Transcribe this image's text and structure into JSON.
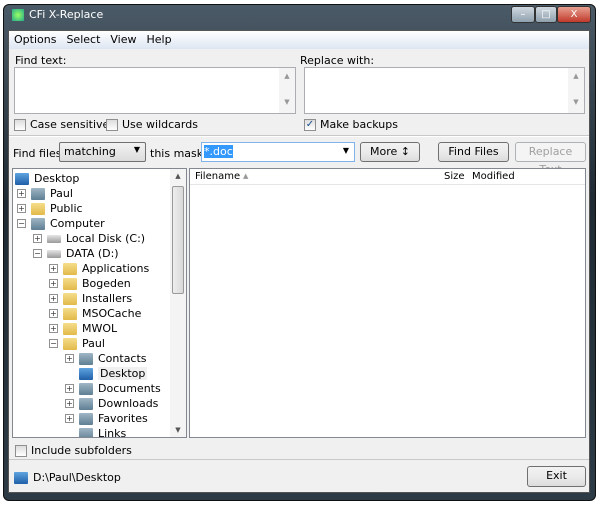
{
  "window": {
    "title": "CFi X-Replace",
    "minimize": "–",
    "maximize": "□",
    "close": "X"
  },
  "menu": [
    {
      "label": "Options"
    },
    {
      "label": "Select"
    },
    {
      "label": "View"
    },
    {
      "label": "Help"
    }
  ],
  "find_text": {
    "label": "Find text:",
    "value": ""
  },
  "replace_with": {
    "label": "Replace with:",
    "value": ""
  },
  "options": {
    "case_sensitive": {
      "label": "Case sensitive",
      "checked": false
    },
    "use_wildcards": {
      "label": "Use wildcards",
      "checked": false
    },
    "make_backups": {
      "label": "Make backups",
      "checked": true,
      "mark": "✓"
    }
  },
  "find_files": {
    "label": "Find files",
    "mode": "matching",
    "mask_label": "this mask:",
    "mask_value": "*.doc",
    "more": "More ↕",
    "find_button": "Find Files",
    "replace_button": "Replace Text"
  },
  "tree": [
    {
      "label": "Desktop",
      "level": 0,
      "icon": "desktop-icon",
      "expander": ""
    },
    {
      "label": "Paul",
      "level": 1,
      "icon": "user-folder-icon",
      "expander": "+"
    },
    {
      "label": "Public",
      "level": 1,
      "icon": "folder-icon",
      "expander": "+"
    },
    {
      "label": "Computer",
      "level": 1,
      "icon": "computer-icon",
      "expander": "−"
    },
    {
      "label": "Local Disk (C:)",
      "level": 2,
      "icon": "drive-icon",
      "expander": "+"
    },
    {
      "label": "DATA (D:)",
      "level": 2,
      "icon": "drive-icon",
      "expander": "−"
    },
    {
      "label": "Applications",
      "level": 3,
      "icon": "folder-icon",
      "expander": "+"
    },
    {
      "label": "Bogeden",
      "level": 3,
      "icon": "folder-icon",
      "expander": "+"
    },
    {
      "label": "Installers",
      "level": 3,
      "icon": "folder-icon",
      "expander": "+"
    },
    {
      "label": "MSOCache",
      "level": 3,
      "icon": "folder-icon",
      "expander": "+"
    },
    {
      "label": "MWOL",
      "level": 3,
      "icon": "folder-icon",
      "expander": "+"
    },
    {
      "label": "Paul",
      "level": 3,
      "icon": "folder-icon",
      "expander": "−"
    },
    {
      "label": "Contacts",
      "level": 4,
      "icon": "contacts-icon",
      "expander": "+"
    },
    {
      "label": "Desktop",
      "level": 4,
      "icon": "desktop-icon",
      "expander": "",
      "selected": true
    },
    {
      "label": "Documents",
      "level": 4,
      "icon": "documents-icon",
      "expander": "+"
    },
    {
      "label": "Downloads",
      "level": 4,
      "icon": "downloads-icon",
      "expander": "+"
    },
    {
      "label": "Favorites",
      "level": 4,
      "icon": "favorites-icon",
      "expander": "+"
    },
    {
      "label": "Links",
      "level": 4,
      "icon": "links-icon",
      "expander": ""
    }
  ],
  "file_list": {
    "columns": [
      "Filename",
      "Size",
      "Modified"
    ],
    "sort_indicator": "▲",
    "rows": []
  },
  "include_subfolders": {
    "label": "Include subfolders",
    "checked": false
  },
  "status": {
    "path": "D:\\Paul\\Desktop",
    "exit": "Exit"
  }
}
